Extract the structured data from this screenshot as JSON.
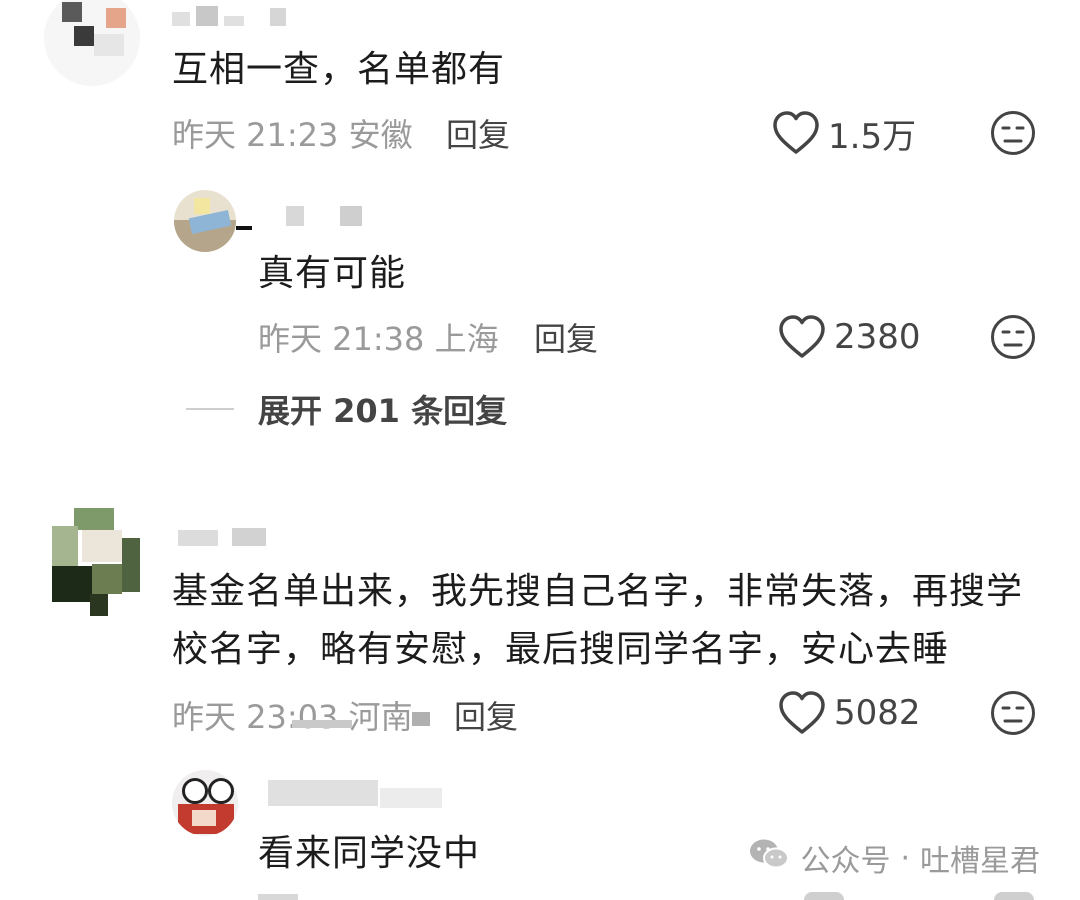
{
  "comments": [
    {
      "content": "互相一查，名单都有",
      "time": "昨天 21:23",
      "location": "安徽",
      "reply_label": "回复",
      "likes": "1.5万",
      "reply": {
        "content": "真有可能",
        "time": "昨天 21:38",
        "location": "上海",
        "reply_label": "回复",
        "likes": "2380"
      },
      "expand_label": "展开 201 条回复"
    },
    {
      "content_lines": [
        "基金名单出来，我先搜自己名字，非常失落，再搜学",
        "校名字，略有安慰，最后搜同学名字，安心去睡"
      ],
      "time": "昨天 23:03",
      "location": "河南",
      "reply_label": "回复",
      "likes": "5082",
      "reply": {
        "content": "看来同学没中"
      }
    }
  ],
  "watermark": {
    "icon": "wechat-icon",
    "source": "公众号",
    "separator": "·",
    "account": "吐槽星君"
  },
  "icons": {
    "like": "heart-outline-icon",
    "emoji": "meh-face-icon"
  },
  "colors": {
    "text_primary": "#1c1c1c",
    "text_secondary": "#9a9a9a",
    "text_action": "#444444"
  }
}
